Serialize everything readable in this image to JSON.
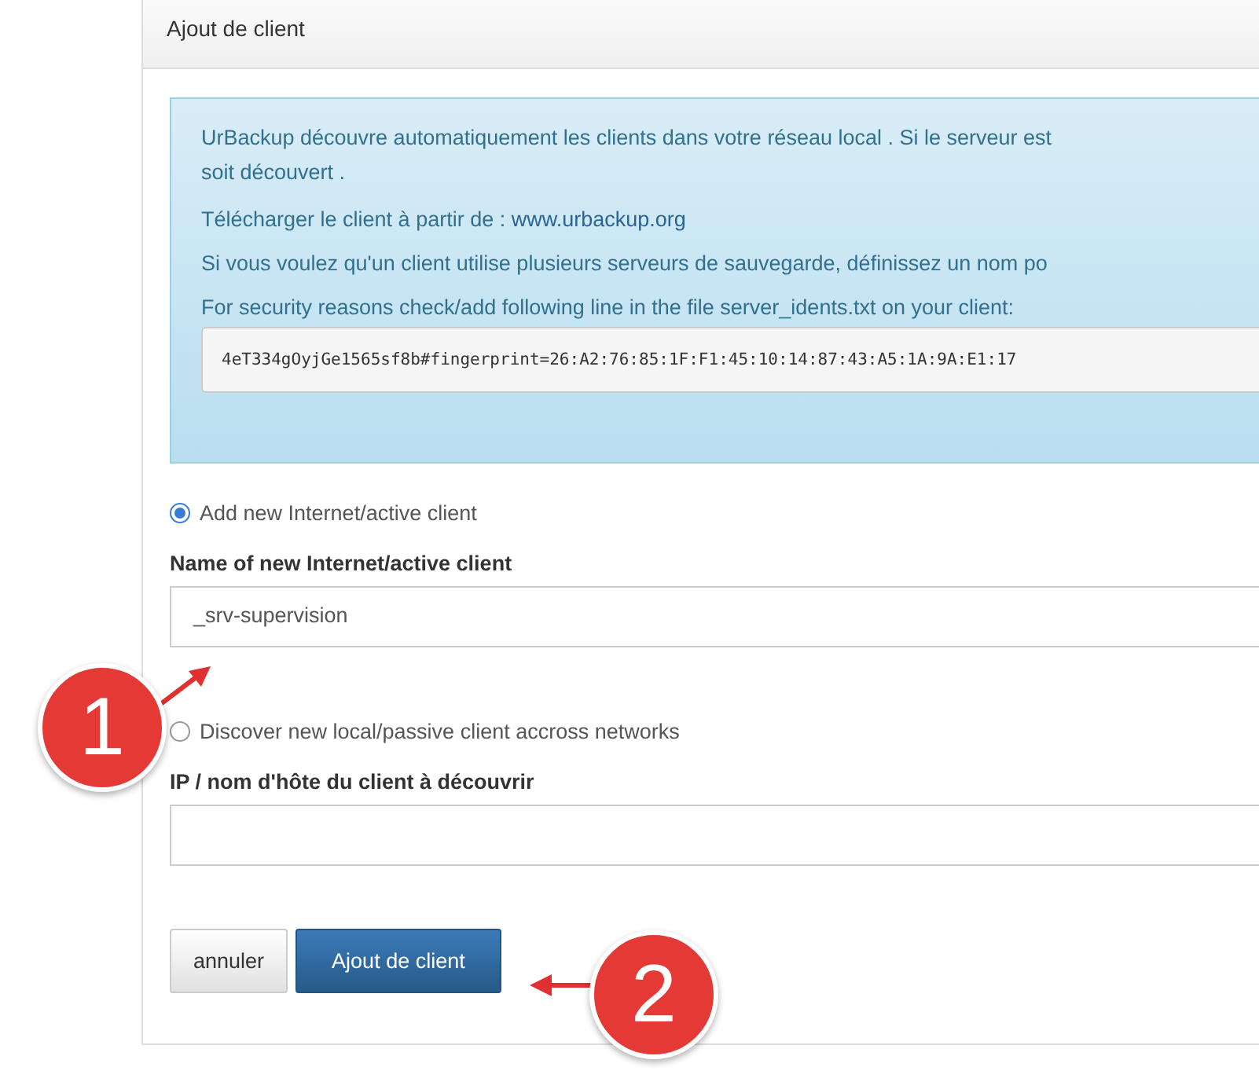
{
  "panel": {
    "title": "Ajout de client"
  },
  "info": {
    "intro_lines": [
      "UrBackup découvre automatiquement les clients dans votre réseau local . Si le serveur est",
      "soit découvert ."
    ],
    "download_text": "Télécharger le client à partir de :",
    "download_link": "www.urbackup.org",
    "multi_server_text": "Si vous voulez qu'un client utilise plusieurs serveurs de sauvegarde, définissez un nom po",
    "security_text": "For security reasons check/add following line in the file server_idents.txt on your client:",
    "ident_line": "4eT334gOyjGe1565sf8b#fingerprint=26:A2:76:85:1F:F1:45:10:14:87:43:A5:1A:9A:E1:17"
  },
  "options": [
    {
      "label": "Add new Internet/active client",
      "selected": true,
      "field_label": "Name of new Internet/active client",
      "value": "_srv-supervision"
    },
    {
      "label": "Discover new local/passive client accross networks",
      "selected": false,
      "field_label": "IP / nom d'hôte du client à découvrir"
    }
  ],
  "buttons": [
    {
      "label": "annuler",
      "kind": "default"
    },
    {
      "label": "Ajout de client",
      "kind": "primary"
    }
  ],
  "callouts": [
    {
      "label": "1"
    },
    {
      "label": "2"
    }
  ]
}
